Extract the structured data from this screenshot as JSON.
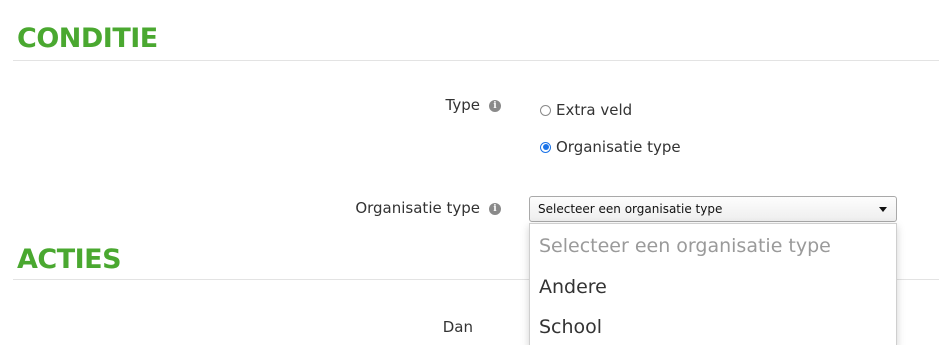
{
  "sections": {
    "condition_title": "CONDITIE",
    "actions_title": "ACTIES"
  },
  "condition": {
    "type_label": "Type",
    "type_options": [
      {
        "label": "Extra veld",
        "selected": false
      },
      {
        "label": "Organisatie type",
        "selected": true
      }
    ],
    "org_type_label": "Organisatie type",
    "org_type_select": {
      "selected_text": "Selecteer een organisatie type",
      "options": [
        {
          "label": "Selecteer een organisatie type",
          "placeholder": true
        },
        {
          "label": "Andere",
          "placeholder": false
        },
        {
          "label": "School",
          "placeholder": false
        }
      ]
    }
  },
  "actions": {
    "then_label": "Dan"
  },
  "icons": {
    "info": "info-icon",
    "dropdown_arrow": "chevron-down-icon"
  },
  "colors": {
    "section_title": "#4aa830",
    "radio_selected": "#1a73e8",
    "placeholder_text": "#9a9a9a"
  }
}
